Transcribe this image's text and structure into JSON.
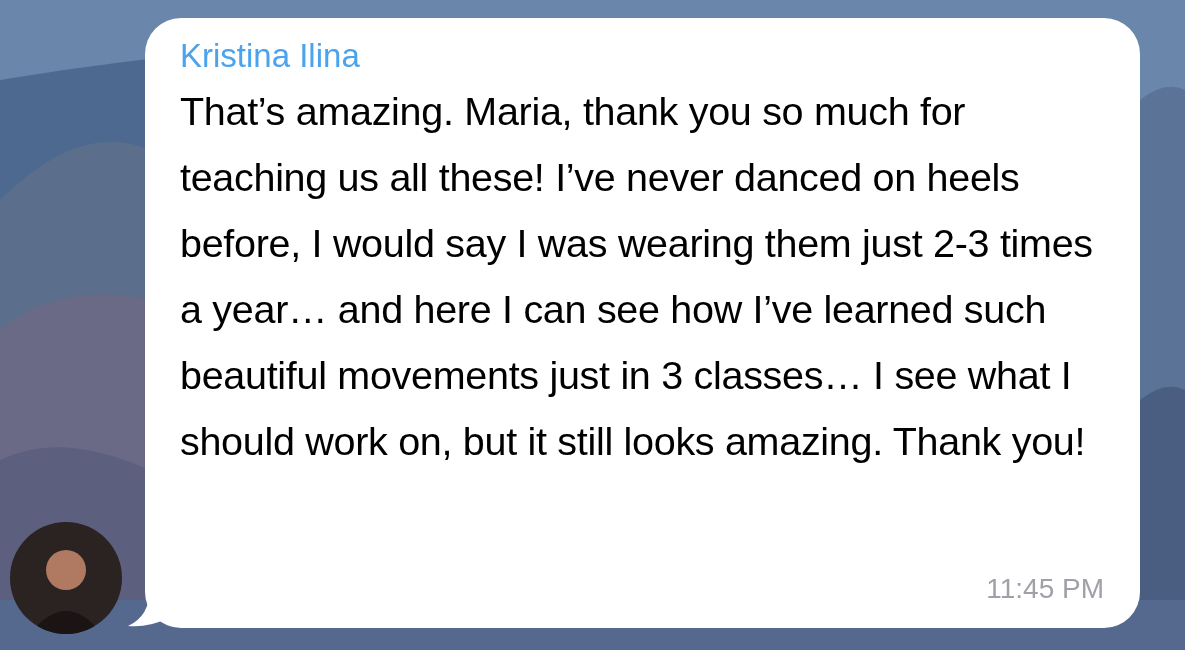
{
  "message": {
    "sender": "Kristina Ilina",
    "text": "That’s amazing. Maria, thank you so much for teaching us all these! I’ve never danced on heels before, I would say I was wearing them just 2-3 times a year… and here I can see how I’ve learned such beautiful movements just in 3 classes… I see what I should work on, but it still looks amazing. Thank you!",
    "time": "11:45 PM"
  }
}
